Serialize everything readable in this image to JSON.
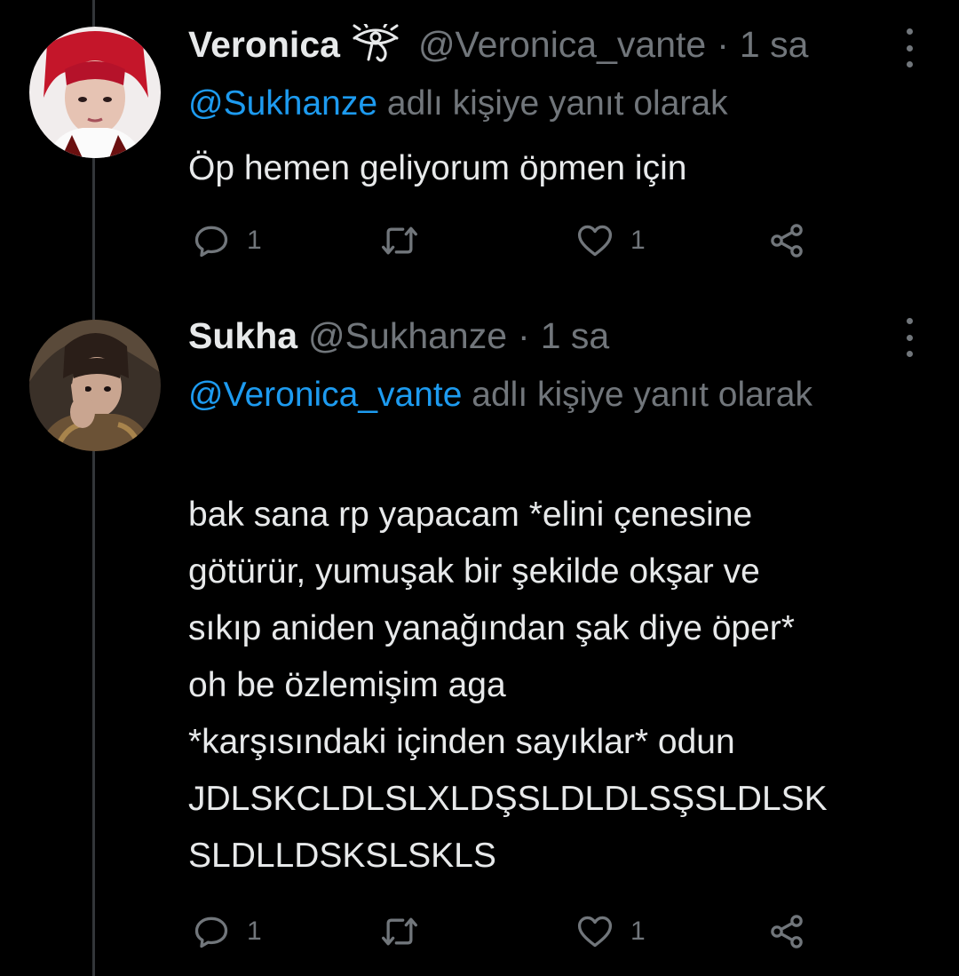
{
  "tweets": [
    {
      "name": "Veronica",
      "handle": "@Veronica_vante",
      "dot": "·",
      "time": "1 sa",
      "name_icon": "eye-of-ra-icon",
      "reply_mention": "@Sukhanze",
      "reply_suffix": " adlı kişiye yanıt olarak",
      "text_lines": [
        "Öp hemen geliyorum öpmen için"
      ],
      "reply_count": "1",
      "like_count": "1"
    },
    {
      "name": "Sukha",
      "handle": "@Sukhanze",
      "dot": "·",
      "time": "1 sa",
      "reply_mention": "@Veronica_vante",
      "reply_suffix": " adlı kişiye yanıt olarak",
      "text_lines": [
        "bak sana rp yapacam *elini çenesine",
        "götürür, yumuşak bir şekilde okşar ve",
        "sıkıp aniden yanağından şak diye öper*",
        "oh be özlemişim aga",
        "*karşısındaki içinden sayıklar* odun",
        "JDLSKCLDLSLXLDŞSLDLDLSŞSLDLSK",
        "SLDLLDSKSLSKLS"
      ],
      "reply_count": "1",
      "like_count": "1"
    }
  ],
  "icons": {
    "reply": "reply-bubble-icon",
    "retweet": "retweet-icon",
    "like": "heart-icon",
    "share": "share-icon",
    "more": "more-options-icon"
  },
  "colors": {
    "background": "#000000",
    "text": "#e7e9ea",
    "secondary": "#71767b",
    "link": "#1d9bf0",
    "thread_line": "#333639"
  }
}
